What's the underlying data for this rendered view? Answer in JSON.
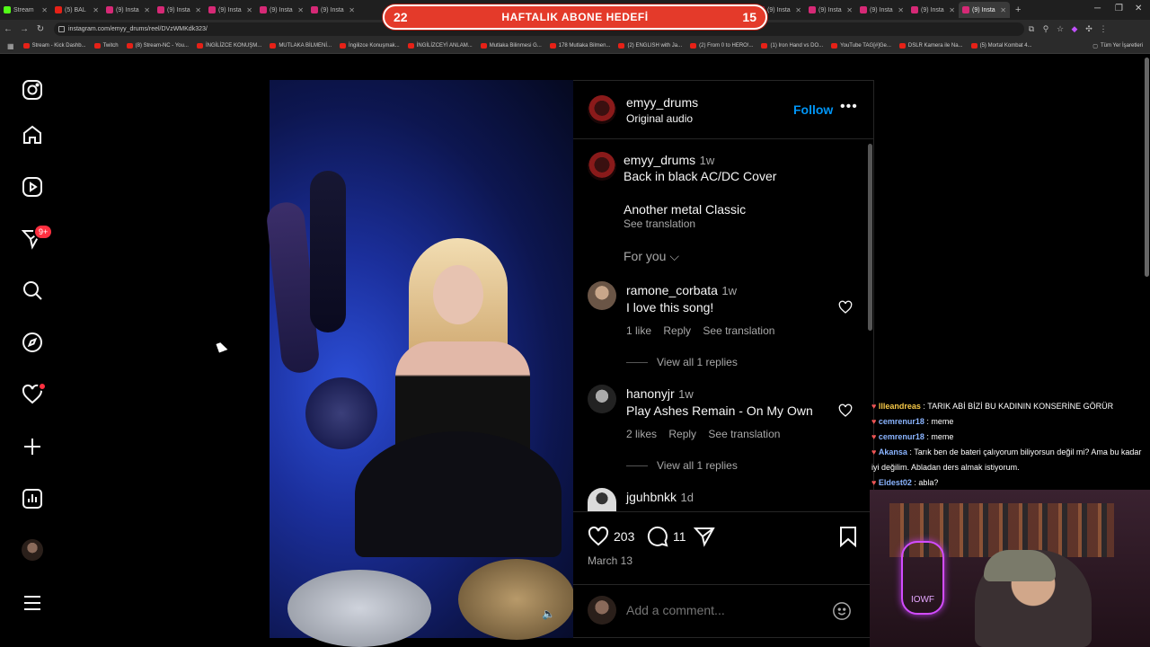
{
  "browser": {
    "tabs": [
      {
        "label": "Stream",
        "color": "#53fc18"
      },
      {
        "label": "(5) BAL",
        "color": "#e62117"
      },
      {
        "label": "(9) Insta",
        "color": "#d62976"
      },
      {
        "label": "(9) Insta",
        "color": "#d62976"
      },
      {
        "label": "(9) Insta",
        "color": "#d62976"
      },
      {
        "label": "(9) Insta",
        "color": "#d62976"
      },
      {
        "label": "(9) Insta",
        "color": "#d62976"
      }
    ],
    "tabs_right": [
      {
        "label": "(9) Insta",
        "color": "#d62976"
      },
      {
        "label": "(9) Insta",
        "color": "#d62976"
      },
      {
        "label": "(9) Insta",
        "color": "#d62976"
      },
      {
        "label": "(9) Insta",
        "color": "#d62976"
      },
      {
        "label": "(9) Insta",
        "color": "#d62976"
      }
    ],
    "url": "instagram.com/emyy_drums/reel/DVzWMKdk323/",
    "bookmarks": [
      "Stream - Kick Dashb...",
      "Twitch",
      "(8) Stream-NC - You...",
      "İNGİLİZCE KONUŞM...",
      "MUTLAKA BİLMENİ...",
      "İngilizce Konuşmak...",
      "İNGİLİZCEYİ ANLAM...",
      "Mutlaka Bilinmesi G...",
      "178 Mutlaka Bilmen...",
      "(2) ENGLISH with Ja...",
      "(2) From 0 to HERO!...",
      "(1) Iron Hand vs DO...",
      "YouTube TAG[#]Ge...",
      "DSLR Kamera ile Na...",
      "(5) Mortal Kombat 4..."
    ],
    "bookmarks_all": "Tüm Yer İşaretleri"
  },
  "overlay_goal": {
    "left": "22",
    "label": "HAFTALIK ABONE HEDEFİ",
    "right": "15"
  },
  "sidebar": {
    "notification_badge": "9+"
  },
  "reel": {
    "owner": "emyy_drums",
    "audio": "Original audio",
    "follow_label": "Follow",
    "caption": {
      "user": "emyy_drums",
      "time": "1w",
      "line1": "Back in black AC/DC Cover",
      "line2": "Another metal Classic",
      "translate": "See translation"
    },
    "for_you": "For you",
    "comments": [
      {
        "user": "ramone_corbata",
        "time": "1w",
        "text": "I love this song!",
        "likes": "1 like",
        "reply": "Reply",
        "translate": "See translation",
        "view": "View all 1 replies"
      },
      {
        "user": "hanonyjr",
        "time": "1w",
        "text": "Play Ashes Remain - On My Own",
        "likes": "2 likes",
        "reply": "Reply",
        "translate": "See translation",
        "view": "View all 1 replies"
      },
      {
        "user": "jguhbnkk",
        "time": "1d"
      }
    ],
    "like_count": "203",
    "comment_count": "11",
    "date": "March 13",
    "comment_placeholder": "Add a comment..."
  },
  "chat": [
    {
      "user": "llleandreas",
      "color": "#f7c948",
      "msg": "TARIK ABİ BİZİ BU KADININ KONSERİNE GÖRÜR"
    },
    {
      "user": "cemrenur18",
      "color": "#8ab4ff",
      "msg": "meme"
    },
    {
      "user": "cemrenur18",
      "color": "#8ab4ff",
      "msg": "meme"
    },
    {
      "user": "Akansa",
      "color": "#8ab4ff",
      "msg": "Tarık ben de bateri çalıyorum biliyorsun değil mi? Ama bu kadar iyi değilim. Abladan ders almak istiyorum."
    },
    {
      "user": "Eldest02",
      "color": "#8ab4ff",
      "msg": "abla?"
    }
  ],
  "cam_neon": "IOWF"
}
